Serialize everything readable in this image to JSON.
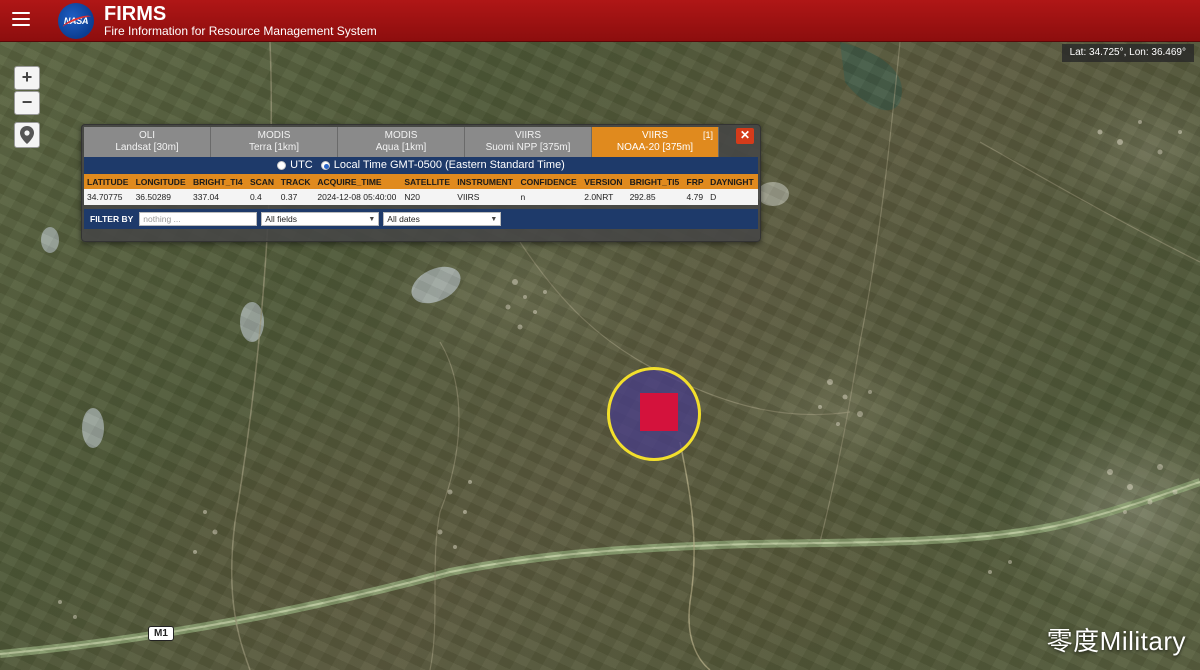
{
  "header": {
    "menu_icon": "hamburger-menu-icon",
    "logo_text": "NASA",
    "title": "FIRMS",
    "subtitle": "Fire Information for Resource Management System"
  },
  "coords": "Lat: 34.725°, Lon: 36.469°",
  "map_controls": {
    "zoom_in": "+",
    "zoom_out": "−",
    "locate_icon": "map-pin-icon"
  },
  "popup": {
    "tabs": [
      {
        "line1": "OLI",
        "line2": "Landsat [30m]",
        "active": false
      },
      {
        "line1": "MODIS",
        "line2": "Terra [1km]",
        "active": false
      },
      {
        "line1": "MODIS",
        "line2": "Aqua [1km]",
        "active": false
      },
      {
        "line1": "VIIRS",
        "line2": "Suomi NPP [375m]",
        "active": false
      },
      {
        "line1": "VIIRS",
        "line2": "NOAA-20 [375m]",
        "active": true,
        "badge": "[1]"
      }
    ],
    "close_label": "✕",
    "time_options": {
      "utc": "UTC",
      "local": "Local Time GMT-0500 (Eastern Standard Time)",
      "selected": "local"
    },
    "columns": [
      "LATITUDE",
      "LONGITUDE",
      "BRIGHT_TI4",
      "SCAN",
      "TRACK",
      "ACQUIRE_TIME",
      "SATELLITE",
      "INSTRUMENT",
      "CONFIDENCE",
      "VERSION",
      "BRIGHT_TI5",
      "FRP",
      "DAYNIGHT"
    ],
    "rows": [
      [
        "34.70775",
        "36.50289",
        "337.04",
        "0.4",
        "0.37",
        "2024-12-08 05:40:00",
        "N20",
        "VIIRS",
        "n",
        "2.0NRT",
        "292.85",
        "4.79",
        "D"
      ]
    ],
    "filter": {
      "label": "FILTER BY",
      "placeholder": "nothing ...",
      "field_select": "All fields",
      "date_select": "All dates"
    }
  },
  "road_label": "M1",
  "watermark": "零度Military",
  "colors": {
    "header": "#a31212",
    "accent_tab": "#e08a1e",
    "fire_pixel": "#d4123c",
    "fire_ring": "#f2df2c"
  }
}
